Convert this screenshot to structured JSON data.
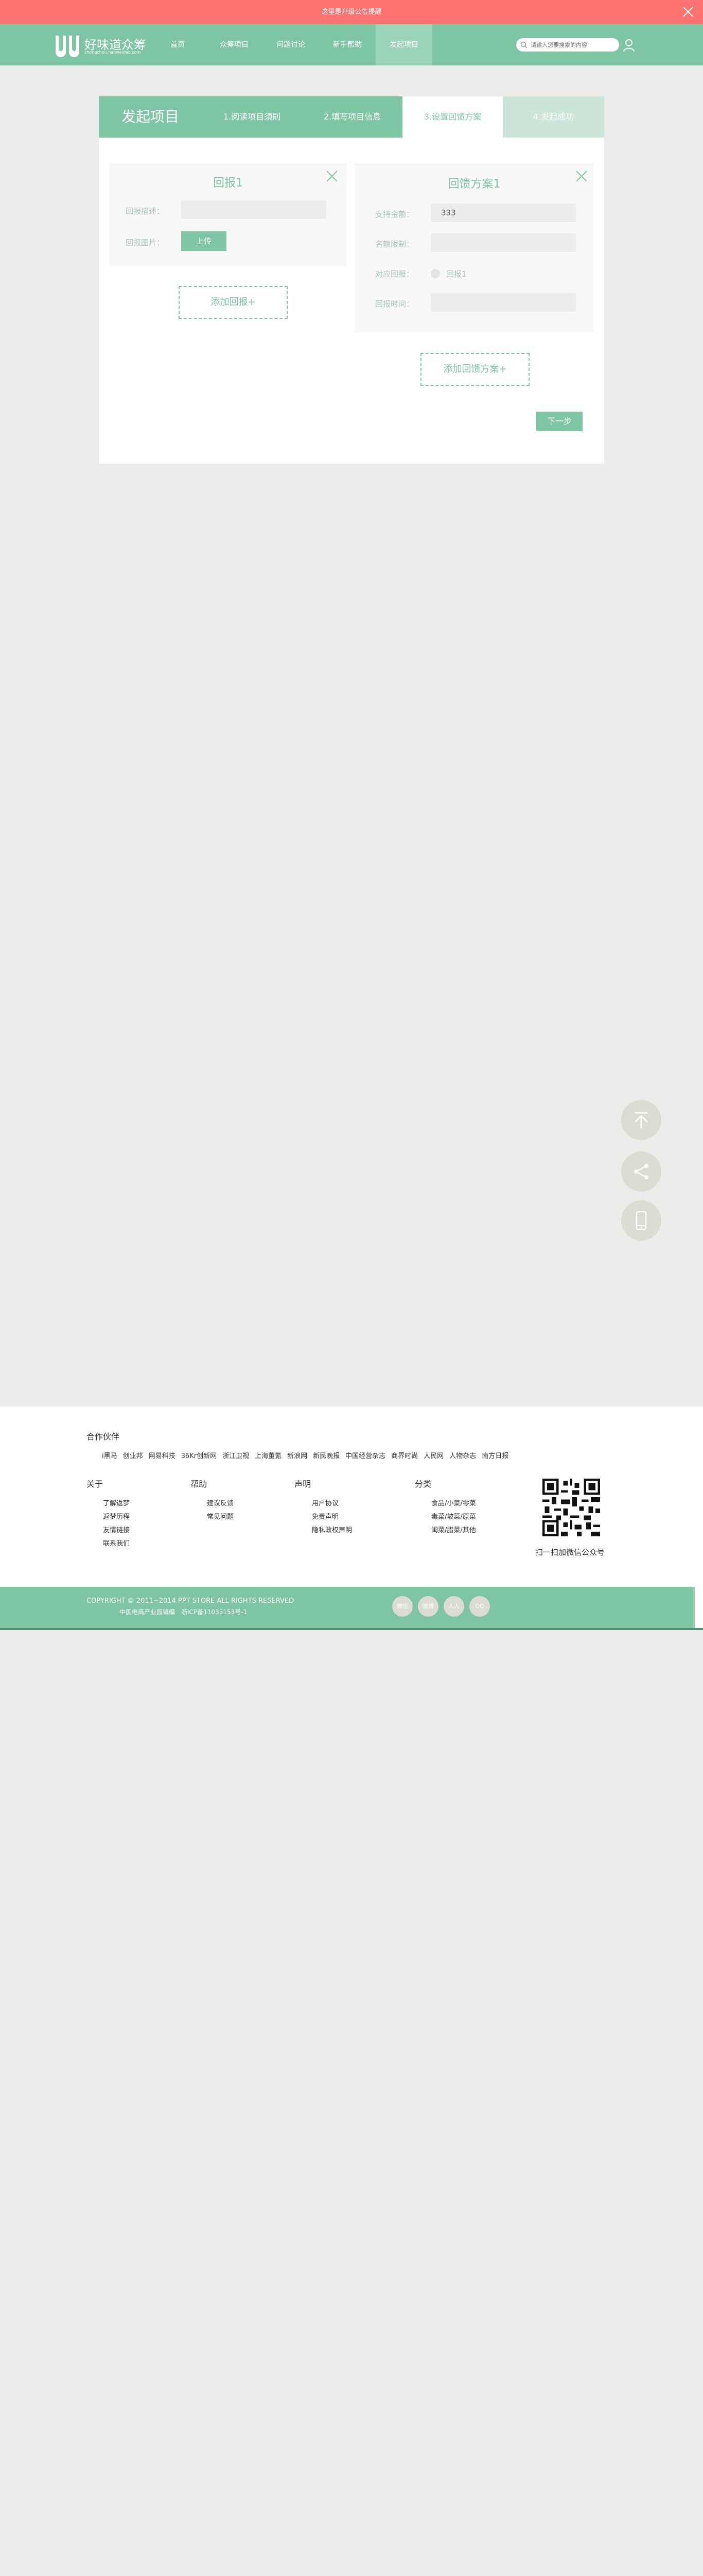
{
  "banner": {
    "text": "这里是升级公告提醒",
    "close_icon": "close-icon"
  },
  "nav": {
    "logo_name": "好味道众筹",
    "logo_sub": "zhongchou.haoweidao.com",
    "items": [
      {
        "label": "首页"
      },
      {
        "label": "众筹项目"
      },
      {
        "label": "问题讨论"
      },
      {
        "label": "新手帮助"
      },
      {
        "label": "发起项目"
      }
    ],
    "active_index": 4,
    "search_placeholder": "请输入您要搜索的内容",
    "accent_color": "#7ec5a4"
  },
  "steps": {
    "title": "发起项目",
    "items": [
      {
        "label": "1.阅读项目須則"
      },
      {
        "label": "2.填写项目信息"
      },
      {
        "label": "3.设置回馈方案"
      },
      {
        "label": "4.发起成功"
      }
    ],
    "active_index": 2
  },
  "reward_panel": {
    "title": "回报1",
    "desc_label": "回报描述：",
    "desc_value": "",
    "image_label": "回报图片：",
    "upload_label": "上传"
  },
  "add_reward_label": "添加回报+",
  "plan_panel": {
    "title": "回馈方案1",
    "amount_label": "支持金额：",
    "amount_value": "333",
    "limit_label": "名额限制：",
    "limit_value": "",
    "reward_label": "对应回报：",
    "reward_option": "回报1",
    "time_label": "回报时间：",
    "time_value": ""
  },
  "add_plan_label": "添加回馈方案+",
  "next_label": "下一步",
  "float_buttons": [
    "back-to-top-icon",
    "share-icon",
    "mobile-icon"
  ],
  "footer": {
    "partners_title": "合作伙伴",
    "partners": [
      "i黑马",
      "创业邦",
      "网易科技",
      "36Kr创新网",
      "浙江卫视",
      "上海董氪",
      "新浪网",
      "新民晚报",
      "中国经营杂志",
      "商界时尚",
      "人民网",
      "人物杂志",
      "南方日报"
    ],
    "columns": [
      {
        "title": "关于",
        "links": [
          "了解返梦",
          "返梦历程",
          "友情链接",
          "联系我们"
        ]
      },
      {
        "title": "帮助",
        "links": [
          "建议反馈",
          "常见问题"
        ]
      },
      {
        "title": "声明",
        "links": [
          "用户协议",
          "免责声明",
          "隐私政权声明"
        ]
      },
      {
        "title": "分类",
        "links": [
          "食品/小菜/零菜",
          "毒菜/坡菜/原菜",
          "闽菜/腊菜/其他"
        ]
      }
    ],
    "qr_caption": "扫一扫加微信公众号"
  },
  "copyright": {
    "line1": "COPYRIGHT © 2011~2014 PPT STORE ALL RIGHTS RESERVED",
    "line2": "中国电商产业园镇编　浙ICP备11035153号-1",
    "share": [
      "微信",
      "微博",
      "人人",
      "QQ"
    ]
  }
}
